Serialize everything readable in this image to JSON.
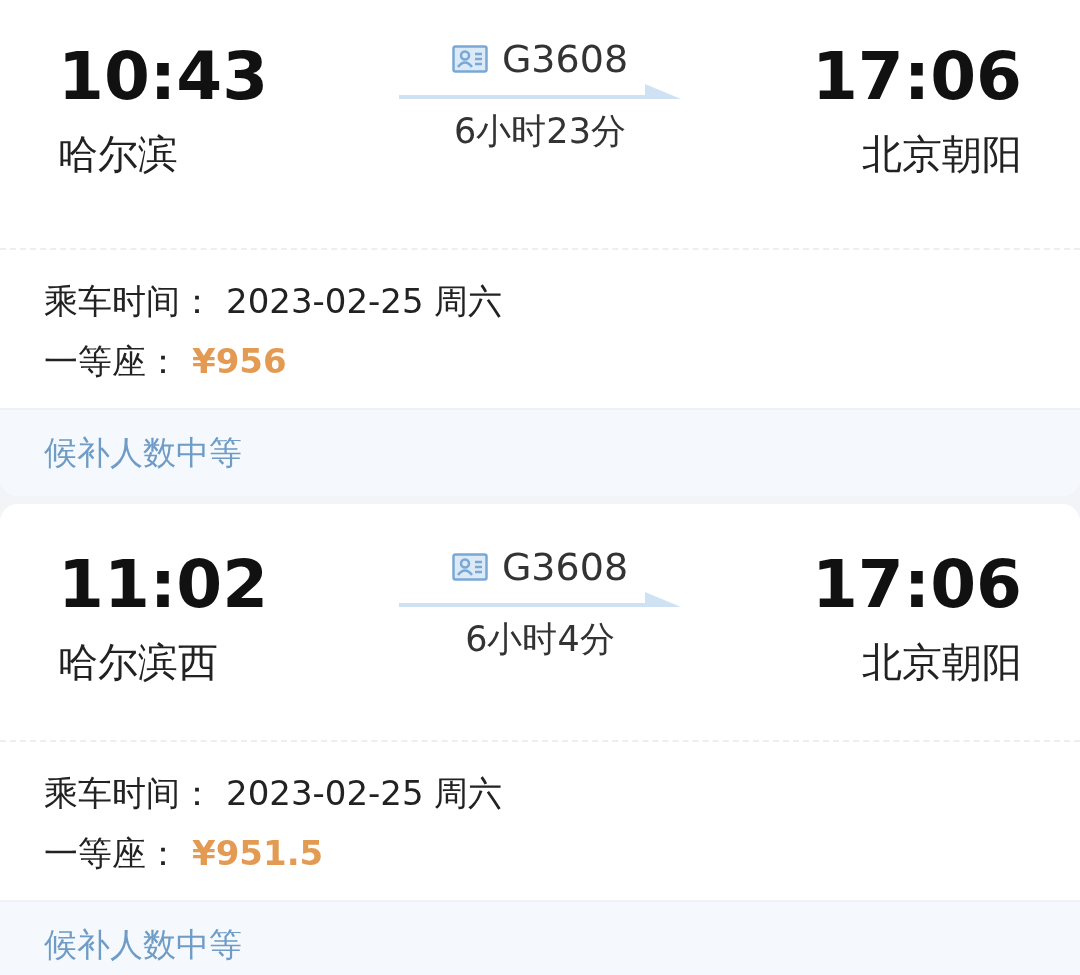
{
  "tickets": [
    {
      "depart_time": "10:43",
      "depart_station": "哈尔滨",
      "train_number": "G3608",
      "duration": "6小时23分",
      "arrive_time": "17:06",
      "arrive_station": "北京朝阳",
      "date_label": "乘车时间：",
      "date": "2023-02-25 周六",
      "seat_label": "一等座：",
      "price": "¥956",
      "footer": "候补人数中等"
    },
    {
      "depart_time": "11:02",
      "depart_station": "哈尔滨西",
      "train_number": "G3608",
      "duration": "6小时4分",
      "arrive_time": "17:06",
      "arrive_station": "北京朝阳",
      "date_label": "乘车时间：",
      "date": "2023-02-25 周六",
      "seat_label": "一等座：",
      "price": "¥951.5",
      "footer": "候补人数中等"
    }
  ]
}
